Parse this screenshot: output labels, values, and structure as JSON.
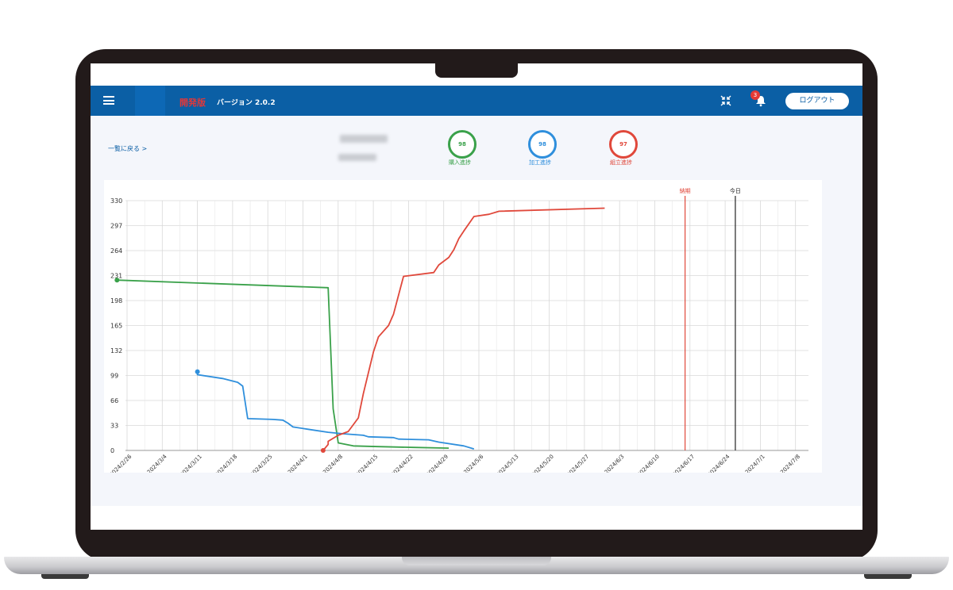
{
  "header": {
    "dev_label": "開発版",
    "version": "バージョン 2.0.2",
    "notification_count": "3",
    "logout_label": "ログアウト"
  },
  "page": {
    "back_link": "一覧に戻る >"
  },
  "progress": [
    {
      "label": "購入進捗",
      "value": "98",
      "color": "#3aa14a"
    },
    {
      "label": "加工進捗",
      "value": "98",
      "color": "#2f8fdc"
    },
    {
      "label": "組立進捗",
      "value": "97",
      "color": "#e0483b"
    }
  ],
  "icons": [
    "menu-icon",
    "compress-icon",
    "bell-icon"
  ],
  "chart_data": {
    "type": "line",
    "y_ticks": [
      "330",
      "297",
      "264",
      "231",
      "198",
      "165",
      "132",
      "99",
      "66",
      "33",
      "0"
    ],
    "ylim": [
      0,
      330
    ],
    "x_ticks": [
      "2024/2/26",
      "2024/3/4",
      "2024/3/11",
      "2024/3/18",
      "2024/3/25",
      "2024/4/1",
      "2024/4/8",
      "2024/4/15",
      "2024/4/22",
      "2024/4/29",
      "2024/5/6",
      "2024/5/13",
      "2024/5/20",
      "2024/5/27",
      "2024/6/3",
      "2024/6/10",
      "2024/6/17",
      "2024/6/24",
      "2024/7/1",
      "2024/7/8"
    ],
    "x_start": "2024-02-26",
    "grid": true,
    "series": [
      {
        "color": "#3aa14a",
        "points": [
          [
            "2024-02-24",
            225
          ],
          [
            "2024-04-06",
            215
          ],
          [
            "2024-04-07",
            55
          ],
          [
            "2024-04-08",
            10
          ],
          [
            "2024-04-11",
            6
          ],
          [
            "2024-04-16",
            5
          ],
          [
            "2024-04-23",
            4
          ],
          [
            "2024-04-30",
            3
          ]
        ]
      },
      {
        "color": "#2f8fdc",
        "points": [
          [
            "2024-03-11",
            104
          ],
          [
            "2024-03-11",
            100
          ],
          [
            "2024-03-16",
            95
          ],
          [
            "2024-03-19",
            90
          ],
          [
            "2024-03-20",
            85
          ],
          [
            "2024-03-21",
            42
          ],
          [
            "2024-03-26",
            41
          ],
          [
            "2024-03-28",
            40
          ],
          [
            "2024-03-29",
            36
          ],
          [
            "2024-03-30",
            31
          ],
          [
            "2024-04-02",
            28
          ],
          [
            "2024-04-06",
            24
          ],
          [
            "2024-04-09",
            22
          ],
          [
            "2024-04-13",
            20
          ],
          [
            "2024-04-14",
            18
          ],
          [
            "2024-04-19",
            17
          ],
          [
            "2024-04-20",
            15
          ],
          [
            "2024-04-26",
            14
          ],
          [
            "2024-04-28",
            11
          ],
          [
            "2024-05-03",
            6
          ],
          [
            "2024-05-05",
            2
          ]
        ]
      },
      {
        "color": "#e0483b",
        "points": [
          [
            "2024-04-05",
            0
          ],
          [
            "2024-04-06",
            8
          ],
          [
            "2024-04-06",
            12
          ],
          [
            "2024-04-08",
            20
          ],
          [
            "2024-04-10",
            25
          ],
          [
            "2024-04-12",
            43
          ],
          [
            "2024-04-13",
            75
          ],
          [
            "2024-04-15",
            130
          ],
          [
            "2024-04-16",
            150
          ],
          [
            "2024-04-18",
            165
          ],
          [
            "2024-04-19",
            180
          ],
          [
            "2024-04-21",
            230
          ],
          [
            "2024-04-27",
            235
          ],
          [
            "2024-04-28",
            245
          ],
          [
            "2024-04-30",
            255
          ],
          [
            "2024-05-01",
            265
          ],
          [
            "2024-05-02",
            280
          ],
          [
            "2024-05-03",
            290
          ],
          [
            "2024-05-05",
            309
          ],
          [
            "2024-05-08",
            312
          ],
          [
            "2024-05-10",
            316
          ],
          [
            "2024-05-31",
            320
          ]
        ]
      }
    ],
    "markers": [
      {
        "label": "納期",
        "date": "2024-06-16",
        "color": "#e0483b"
      },
      {
        "label": "今日",
        "date": "2024-06-26",
        "color": "#222222"
      }
    ]
  }
}
